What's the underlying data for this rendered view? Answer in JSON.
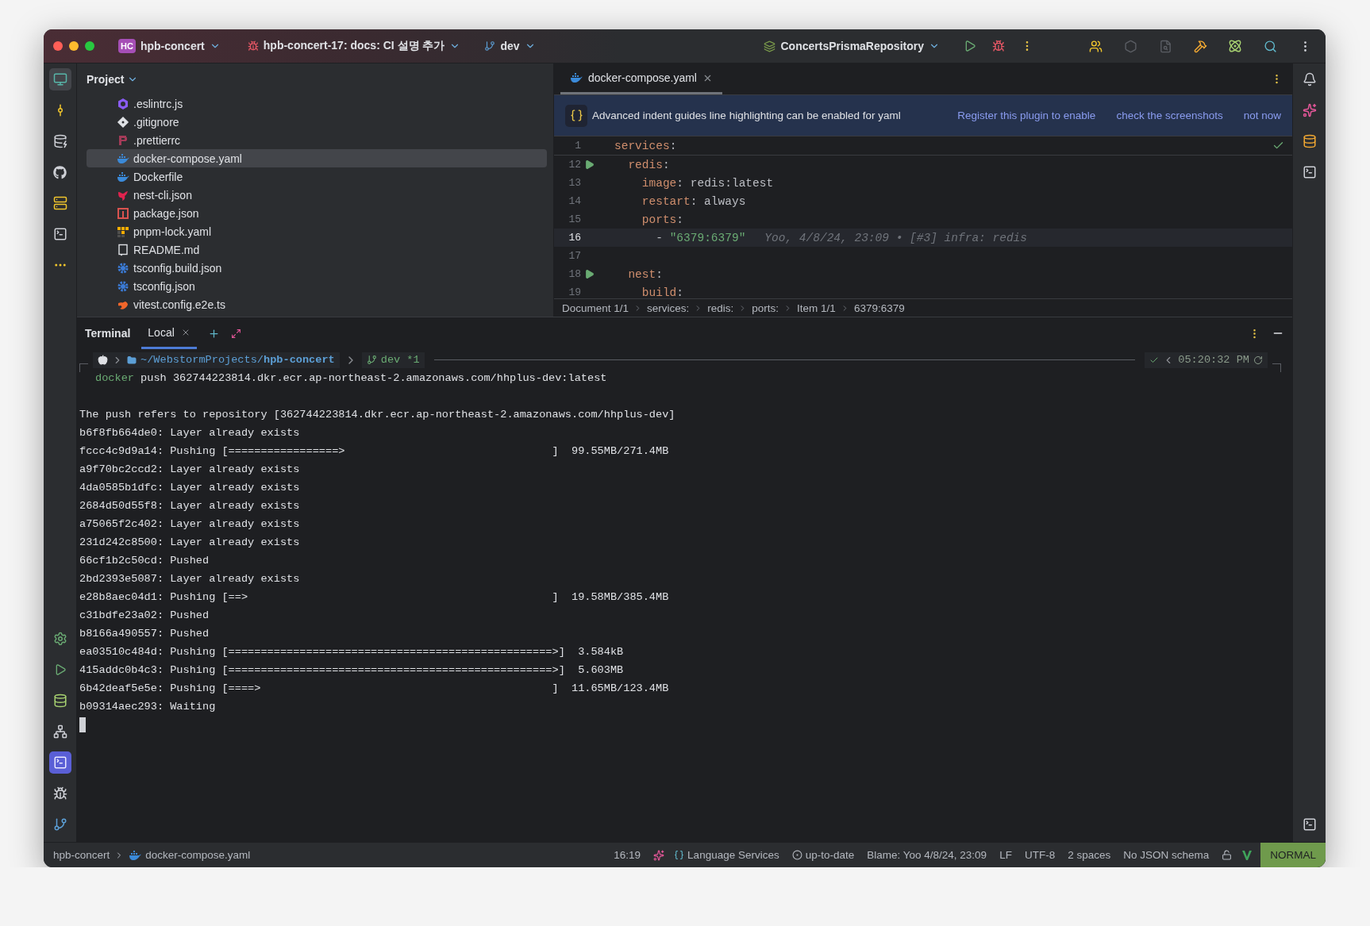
{
  "title_bar": {
    "project_badge": "HC",
    "project": "hpb-concert",
    "task": "hpb-concert-17: docs: CI 설명 추가",
    "branch": "dev",
    "run_config": "ConcertsPrismaRepository"
  },
  "project_panel": {
    "title": "Project",
    "files": [
      {
        "name": ".eslintrc.js",
        "kind": "eslint",
        "selected": false
      },
      {
        "name": ".gitignore",
        "kind": "git",
        "selected": false
      },
      {
        "name": ".prettierrc",
        "kind": "prettier",
        "selected": false
      },
      {
        "name": "docker-compose.yaml",
        "kind": "docker",
        "selected": true
      },
      {
        "name": "Dockerfile",
        "kind": "docker",
        "selected": false
      },
      {
        "name": "nest-cli.json",
        "kind": "nest",
        "selected": false
      },
      {
        "name": "package.json",
        "kind": "npm",
        "selected": false
      },
      {
        "name": "pnpm-lock.yaml",
        "kind": "pnpm",
        "selected": false
      },
      {
        "name": "README.md",
        "kind": "readme",
        "selected": false
      },
      {
        "name": "tsconfig.build.json",
        "kind": "tsconfig",
        "selected": false
      },
      {
        "name": "tsconfig.json",
        "kind": "tsconfig",
        "selected": false
      },
      {
        "name": "vitest.config.e2e.ts",
        "kind": "vitest",
        "selected": false
      }
    ]
  },
  "editor": {
    "tabs": [
      {
        "label": "docker-compose.yaml",
        "selected": true
      }
    ],
    "banner": {
      "text": "Advanced indent guides line highlighting can be enabled for yaml",
      "actions": [
        "Register this plugin to enable",
        "check the screenshots",
        "not now"
      ]
    },
    "lines": [
      {
        "number": "1",
        "code": "services:",
        "kind": "sticky",
        "runnable": false,
        "current": false
      },
      {
        "number": "12",
        "code": "  redis:",
        "kind": "code",
        "runnable": true,
        "current": false
      },
      {
        "number": "13",
        "code": "    image: redis:latest",
        "kind": "code",
        "runnable": false,
        "current": false
      },
      {
        "number": "14",
        "code": "    restart: always",
        "kind": "code",
        "runnable": false,
        "current": false
      },
      {
        "number": "15",
        "code": "    ports:",
        "kind": "code",
        "runnable": false,
        "current": false
      },
      {
        "number": "16",
        "code": "      - \"6379:6379\"",
        "kind": "code",
        "runnable": false,
        "current": true,
        "blame": "Yoo, 4/8/24, 23:09 • [#3] infra: redis"
      },
      {
        "number": "17",
        "kind": "code",
        "runnable": false,
        "current": false
      },
      {
        "number": "18",
        "code": "  nest:",
        "kind": "code",
        "runnable": true,
        "current": false
      },
      {
        "number": "19",
        "code": "    build:",
        "kind": "code",
        "runnable": false,
        "current": false
      }
    ],
    "breadcrumbs": [
      "Document 1/1",
      "services:",
      "redis:",
      "ports:",
      "Item 1/1",
      "6379:6379"
    ]
  },
  "terminal": {
    "title": "Terminal",
    "tabs": [
      {
        "label": "Local",
        "selected": true
      }
    ],
    "prompt": {
      "path": "~/WebstormProjects/**hpb-concert**",
      "branch": "dev *1",
      "time": "05:20:32 PM",
      "command": "docker",
      "args": "push 362744223814.dkr.ecr.ap-northeast-2.amazonaws.com/hhplus-dev:latest"
    },
    "output": [
      "The push refers to repository [362744223814.dkr.ecr.ap-northeast-2.amazonaws.com/hhplus-dev]",
      "b6f8fb664de0: Layer already exists",
      "fccc4c9d9a14: Pushing [=================>                                ]  99.55MB/271.4MB",
      "a9f70bc2ccd2: Layer already exists",
      "4da0585b1dfc: Layer already exists",
      "2684d50d55f8: Layer already exists",
      "a75065f2c402: Layer already exists",
      "231d242c8500: Layer already exists",
      "66cf1b2c50cd: Pushed",
      "2bd2393e5087: Layer already exists",
      "e28b8aec04d1: Pushing [==>                                               ]  19.58MB/385.4MB",
      "c31bdfe23a02: Pushed",
      "b8166a490557: Pushed",
      "ea03510c484d: Pushing [==================================================>]  3.584kB",
      "415addc0b4c3: Pushing [==================================================>]  5.603MB",
      "6b42deaf5e5e: Pushing [====>                                             ]  11.65MB/123.4MB",
      "b09314aec293: Waiting"
    ]
  },
  "status_bar": {
    "breadcrumbs": [
      "hpb-concert",
      "docker-compose.yaml"
    ],
    "position": "16:19",
    "language_services": "Language Services",
    "vcs": "up-to-date",
    "blame": "Blame: Yoo 4/8/24, 23:09",
    "line_separator": "LF",
    "encoding": "UTF-8",
    "indent": "2 spaces",
    "schema": "No JSON schema",
    "mode": "NORMAL"
  }
}
